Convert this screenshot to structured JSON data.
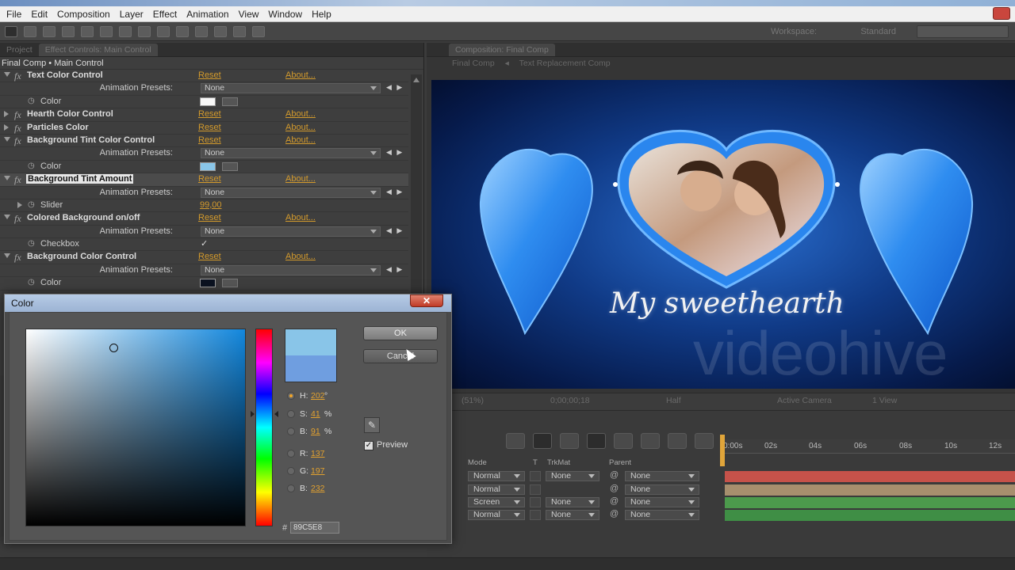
{
  "menu": [
    "File",
    "Edit",
    "Composition",
    "Layer",
    "Effect",
    "Animation",
    "View",
    "Window",
    "Help"
  ],
  "toolbar": {
    "workspace_label": "Workspace:",
    "workspace_value": "Standard",
    "search_placeholder": ""
  },
  "effect_panel": {
    "tabs": [
      "Project",
      "Effect Controls: Main Control"
    ],
    "breadcrumb": "Final Comp • Main Control",
    "reset_label": "Reset",
    "about_label": "About...",
    "presets_label": "Animation Presets:",
    "preset_value": "None",
    "effects": [
      {
        "name": "Text Color Control",
        "prop": "Color"
      },
      {
        "name": "Hearth Color Control"
      },
      {
        "name": "Particles Color"
      },
      {
        "name": "Background Tint Color Control",
        "prop": "Color"
      },
      {
        "name": "Background Tint Amount",
        "prop": "Slider",
        "value": "99,00"
      },
      {
        "name": "Colored Background on/off",
        "prop": "Checkbox",
        "check": "✓"
      },
      {
        "name": "Background Color Control",
        "prop": "Color"
      }
    ]
  },
  "comp_panel": {
    "tab": "Composition: Final Comp",
    "breadcrumb_1": "Final Comp",
    "breadcrumb_2": "Text Replacement Comp",
    "title_text": "My sweethearth",
    "watermark": "videohive",
    "viewer_bar": {
      "zoom": "(51%)",
      "timecode": "0;00;00;18",
      "resolution": "Half",
      "camera": "Active Camera",
      "views": "1 View"
    }
  },
  "timeline": {
    "ruler": [
      "0:00s",
      "02s",
      "04s",
      "06s",
      "08s",
      "10s",
      "12s"
    ],
    "headers": {
      "mode": "Mode",
      "t": "T",
      "trkmat": "TrkMat",
      "parent": "Parent"
    },
    "layers": [
      {
        "mode": "Normal",
        "trkmat": "None",
        "parent": "None",
        "color": "#c6524a"
      },
      {
        "mode": "Normal",
        "trkmat": "",
        "parent": "None",
        "color": "#a78f6e"
      },
      {
        "mode": "Screen",
        "trkmat": "None",
        "parent": "None",
        "color": "#4c9a4c"
      },
      {
        "mode": "Normal",
        "trkmat": "None",
        "parent": "None",
        "color": "#3f8e45"
      }
    ]
  },
  "color_dialog": {
    "title": "Color",
    "close": "✕",
    "ok": "OK",
    "cancel": "Cancel",
    "preview": "Preview",
    "preview_check": "✓",
    "new_color": "#89c5e8",
    "old_color": "#6f9ee0",
    "fields": [
      {
        "label": "H:",
        "value": "202",
        "unit": "°",
        "selected": true
      },
      {
        "label": "S:",
        "value": "41",
        "unit": "%"
      },
      {
        "label": "B:",
        "value": "91",
        "unit": "%"
      },
      {
        "label": "R:",
        "value": "137"
      },
      {
        "label": "G:",
        "value": "197"
      },
      {
        "label": "B:",
        "value": "232"
      }
    ],
    "hex_label": "#",
    "hex": "89C5E8"
  }
}
